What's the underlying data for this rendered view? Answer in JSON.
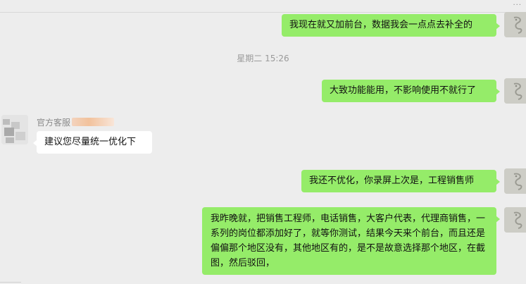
{
  "chat": {
    "timestamp": "星期二 15:26",
    "top_corner": "...",
    "messages": [
      {
        "direction": "sent",
        "text": "我现在就又加前台，数据我会一点点去补全的"
      },
      {
        "direction": "sent",
        "text": "大致功能能用，不影响使用不就行了"
      },
      {
        "direction": "received",
        "sender": "官方客服",
        "text": "建议您尽量统一优化下"
      },
      {
        "direction": "sent",
        "text": "我还不优化，你录屏上次是，工程销售师"
      },
      {
        "direction": "sent",
        "text": "我昨晚就，把销售工程师，电话销售，大客户代表，代理商销售，一系列的岗位都添加好了，就等你测试，结果今天来个前台，而且还是偏偏那个地区没有，其他地区有的，是不是故意选择那个地区，在截图，然后驳回，"
      }
    ]
  },
  "colors": {
    "sent_bubble": "#95ec69",
    "received_bubble": "#ffffff",
    "background": "#ededed"
  }
}
